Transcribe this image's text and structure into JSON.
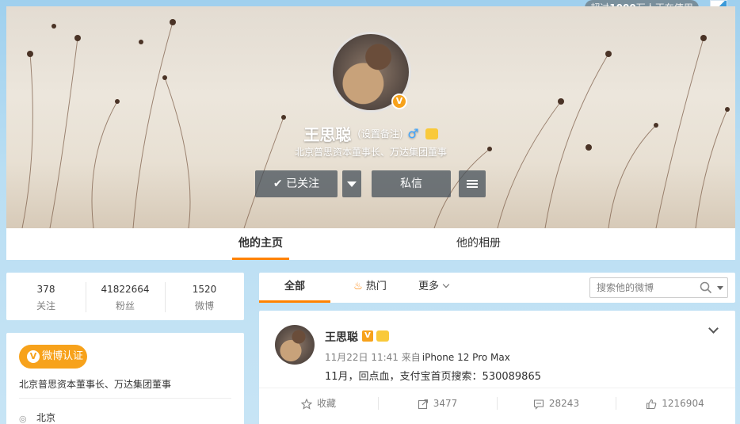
{
  "top_badge": {
    "prefix": "超过",
    "count": "1000",
    "suffix": "万人正在使用"
  },
  "profile": {
    "name": "王思聪",
    "remark": "(设置备注)",
    "gender_icon": "♂",
    "bio": "北京普思资本董事长、万达集团董事"
  },
  "actions": {
    "follow_label": "✔ 已关注",
    "message_label": "私信"
  },
  "tabs": {
    "home": "他的主页",
    "album": "他的相册"
  },
  "stats": [
    {
      "value": "378",
      "label": "关注"
    },
    {
      "value": "41822664",
      "label": "粉丝"
    },
    {
      "value": "1520",
      "label": "微博"
    }
  ],
  "verification": {
    "badge_label": "微博认证",
    "badge_icon_char": "V",
    "description": "北京普思资本董事长、万达集团董事",
    "location": "北京"
  },
  "feed_tabs": {
    "all": "全部",
    "hot": "热门",
    "more": "更多"
  },
  "search": {
    "placeholder": "搜索他的微博"
  },
  "post": {
    "author": "王思聪",
    "time": "11月22日 11:41",
    "source_prefix": "来自",
    "source": "iPhone 12 Pro Max",
    "text": "11月，回点血，支付宝首页搜索：530089865",
    "favorite_label": "收藏",
    "reposts": "3477",
    "comments": "28243",
    "likes": "1216904"
  },
  "colors": {
    "accent": "#ff8200",
    "verified": "#f7a21b",
    "male": "#3ea5ff"
  }
}
